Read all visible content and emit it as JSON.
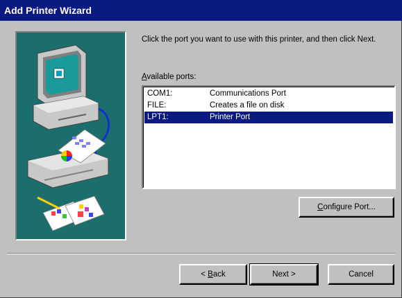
{
  "window": {
    "title": "Add Printer Wizard"
  },
  "instructions": "Click the port you want to use with this printer, and then click Next.",
  "ports": {
    "label_prefix": "",
    "label_mnemonic": "A",
    "label_rest": "vailable ports:",
    "items": [
      {
        "port": "COM1:",
        "description": "Communications Port",
        "selected": false
      },
      {
        "port": "FILE:",
        "description": "Creates a file on disk",
        "selected": false
      },
      {
        "port": "LPT1:",
        "description": "Printer Port",
        "selected": true
      }
    ]
  },
  "buttons": {
    "configure": {
      "mnemonic": "C",
      "rest": "onfigure Port..."
    },
    "back": {
      "prefix": "< ",
      "mnemonic": "B",
      "rest": "ack"
    },
    "next": {
      "label": "Next >"
    },
    "cancel": {
      "label": "Cancel"
    }
  },
  "colors": {
    "face": "#c0c0c0",
    "titlebar": "#0a1a80",
    "selection": "#0a1a80",
    "illustration_bg": "#1c6e6c"
  },
  "icons": {
    "illustration": "computer-printer-illustration"
  }
}
